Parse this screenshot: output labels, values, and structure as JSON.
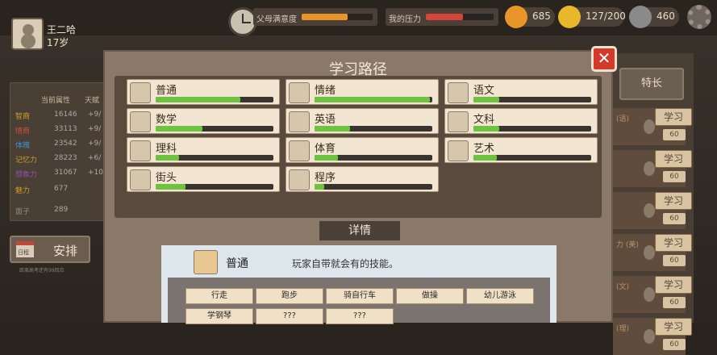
{
  "player": {
    "name": "王二哈",
    "age": "17岁"
  },
  "topbar": {
    "parent_satisfaction": {
      "label": "父母满意度",
      "fill": 0.65,
      "color": "#e8962a"
    },
    "my_pressure": {
      "label": "我的压力",
      "fill": 0.55,
      "color": "#d4453a"
    },
    "resources": [
      {
        "icon": "fire-icon",
        "value": "685",
        "color": "#e8962a"
      },
      {
        "icon": "lightning-icon",
        "value": "127/200",
        "color": "#e8b82a"
      },
      {
        "icon": "coin-icon",
        "value": "460",
        "color": "#8a8a8a"
      }
    ]
  },
  "left_panel": {
    "headers": [
      "当前属性",
      "天赋"
    ],
    "rows": [
      {
        "label": "智商",
        "value": "16146",
        "delta": "+9/",
        "color": "#c8a030"
      },
      {
        "label": "情商",
        "value": "33113",
        "delta": "+9/",
        "color": "#c85040"
      },
      {
        "label": "体魄",
        "value": "23542",
        "delta": "+9/",
        "color": "#4090c8"
      },
      {
        "label": "记忆力",
        "value": "28223",
        "delta": "+6/",
        "color": "#c8a030"
      },
      {
        "label": "想象力",
        "value": "31067",
        "delta": "+10/",
        "color": "#9050b0"
      },
      {
        "label": "魅力",
        "value": "677",
        "delta": "",
        "color": "#c8a030"
      },
      {
        "label": "面子",
        "value": "289",
        "delta": "",
        "color": "#888888"
      }
    ],
    "arrange_button": {
      "label": "安排",
      "calendar": "日程"
    },
    "arrange_note": "距离高考还有99回合"
  },
  "right_panel": {
    "speciality_button": "特长",
    "rows": [
      {
        "label": "(语)",
        "button": "学习",
        "value": "60"
      },
      {
        "label": "",
        "button": "学习",
        "value": "60"
      },
      {
        "label": "",
        "button": "学习",
        "value": "60"
      },
      {
        "label": "力 (美)",
        "button": "学习",
        "value": "60"
      },
      {
        "label": "(文)",
        "button": "学习",
        "value": "60"
      },
      {
        "label": "(理)",
        "button": "学习",
        "value": "60"
      }
    ]
  },
  "dialog": {
    "title": "学习路径",
    "close_label": "✕",
    "skills": [
      {
        "name": "普通",
        "fill": 0.72,
        "icon": "hand-icon"
      },
      {
        "name": "情绪",
        "fill": 0.98,
        "icon": "emotion-icon"
      },
      {
        "name": "语文",
        "fill": 0.22,
        "icon": "book-icon"
      },
      {
        "name": "数学",
        "fill": 0.4,
        "icon": "grid-icon"
      },
      {
        "name": "英语",
        "fill": 0.3,
        "icon": "hello-bubble-icon"
      },
      {
        "name": "文科",
        "fill": 0.22,
        "icon": "globe-icon"
      },
      {
        "name": "理科",
        "fill": 0.2,
        "icon": "flask-icon"
      },
      {
        "name": "体育",
        "fill": 0.2,
        "icon": "basketball-icon"
      },
      {
        "name": "艺术",
        "fill": 0.2,
        "icon": "palette-icon"
      },
      {
        "name": "街头",
        "fill": 0.25,
        "icon": "hoodie-icon"
      },
      {
        "name": "程序",
        "fill": 0.08,
        "icon": "computer-icon"
      }
    ],
    "details": {
      "header": "详情",
      "skill_name": "普通",
      "description": "玩家自带就会有的技能。",
      "actions": [
        "行走",
        "跑步",
        "骑自行车",
        "做操",
        "幼儿游泳",
        "学钢琴",
        "???",
        "???"
      ]
    }
  }
}
